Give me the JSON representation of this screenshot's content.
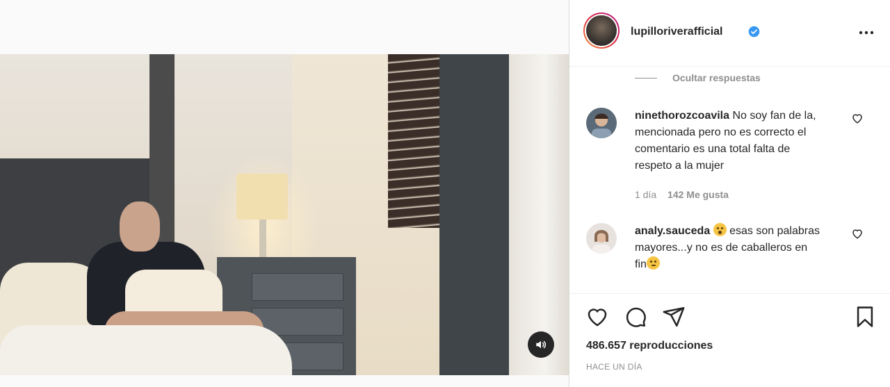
{
  "post": {
    "username": "lupilloriverafficial",
    "verified": true,
    "views_count": "486.657",
    "views_label": "reproducciones",
    "timestamp": "HACE UN DÍA"
  },
  "comments": {
    "hide_replies_label": "Ocultar respuestas",
    "items": [
      {
        "username": "ninethorozcoavila",
        "text": "No soy fan de la, mencionada pero no es correcto el comentario es una total falta de respeto a la mujer",
        "age": "1 día",
        "likes": "142 Me gusta"
      },
      {
        "username": "analy.sauceda",
        "text_before_emoji": "",
        "text_after_emoji": "esas son palabras mayores...y no es de caballeros en fin"
      }
    ]
  },
  "icons": {
    "sound": "speaker-icon",
    "more": "more-options-icon",
    "like": "heart-icon",
    "comment": "comment-bubble-icon",
    "share": "paper-plane-icon",
    "save": "bookmark-icon"
  },
  "colors": {
    "accent_blue": "#3897f0",
    "text_primary": "#262626",
    "text_secondary": "#8e8e8e",
    "border": "#dbdbdb"
  }
}
